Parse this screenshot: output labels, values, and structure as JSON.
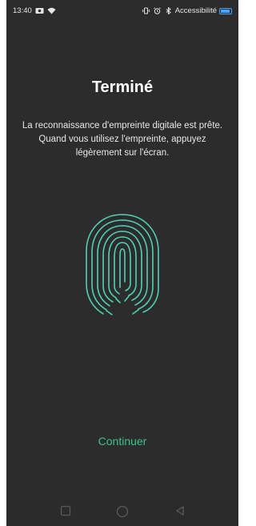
{
  "status_bar": {
    "time": "13:40",
    "accessibility_label": "Accessibilité",
    "left_icons": [
      "photo-icon",
      "wifi-icon"
    ],
    "right_icons": [
      "vibrate-icon",
      "alarm-icon",
      "bluetooth-icon",
      "battery-icon"
    ],
    "battery_color": "#4aa3ff"
  },
  "main": {
    "title": "Terminé",
    "description": "La reconnaissance d'empreinte digitale est prête. Quand vous utilisez l'empreinte, appuyez légèrement sur l'écran.",
    "fingerprint_icon": "fingerprint-icon",
    "fingerprint_color": "#4fd1b0",
    "continue_label": "Continuer",
    "continue_color": "#38c28a"
  },
  "nav_bar": {
    "buttons": [
      "recents-icon",
      "home-icon",
      "back-icon"
    ]
  },
  "colors": {
    "background": "#2c2c2c",
    "text": "#ffffff"
  }
}
